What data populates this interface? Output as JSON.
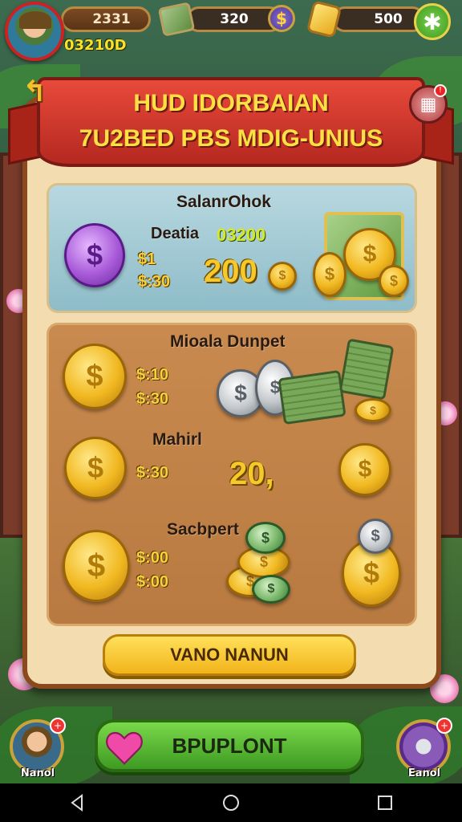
{
  "hud": {
    "level": "2331",
    "player_tag": "03210D",
    "cash": "320",
    "gold": "500",
    "add_cash_symbol": "$",
    "add_gold_symbol": "✱"
  },
  "banner": {
    "title": "HUD IDORBAIAN",
    "subtitle": "7U2BED PBS MDIG-UNIUS"
  },
  "offers": {
    "featured": {
      "title": "SalanrOhok",
      "label": "Deatia",
      "bonus": "03200",
      "price_1": "$1",
      "price_2": "$:30",
      "amount": "200"
    },
    "bundle": {
      "title": "Mioala Dunpet",
      "price_1": "$:10",
      "price_2": "$:30"
    },
    "manual": {
      "title": "Mahirl",
      "price": "$:30",
      "amount": "20,"
    },
    "support": {
      "title": "Sacbpert",
      "price_1": "$:00",
      "price_2": "$:00"
    }
  },
  "cta": {
    "label": "VANO NANUN"
  },
  "bottom": {
    "left_avatar_label": "Nanol",
    "right_avatar_label": "Eanol",
    "play_label": "BPUPLONT"
  },
  "colors": {
    "banner_red": "#d43a2a",
    "panel_cream": "#f3ddb0",
    "gold": "#f2b41a",
    "play_green": "#5cbc32"
  },
  "icons": [
    "cash-icon",
    "gold-bar-icon",
    "gift-icon",
    "heart-icon",
    "back-arrow-icon"
  ]
}
